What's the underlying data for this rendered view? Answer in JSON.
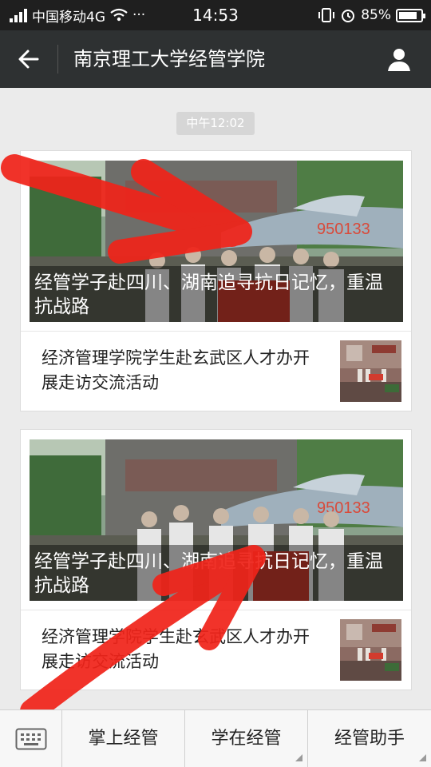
{
  "status_bar": {
    "carrier": "中国移动4G",
    "more": "···",
    "time": "14:53",
    "battery": "85%",
    "battery_level": 0.85
  },
  "nav": {
    "title": "南京理工大学经管学院"
  },
  "chat": {
    "timestamp": "中午12:02"
  },
  "articles": [
    {
      "main_title": "经管学子赴四川、湖南追寻抗日记忆，重温抗战路",
      "sub_title": "经济管理学院学生赴玄武区人才办开展走访交流活动"
    },
    {
      "main_title": "经管学子赴四川、湖南追寻抗日记忆，重温抗战路",
      "sub_title": "经济管理学院学生赴玄武区人才办开展走访交流活动"
    }
  ],
  "menu": {
    "items": [
      "掌上经管",
      "学在经管",
      "经管助手"
    ]
  },
  "colors": {
    "nav_bg": "#2e3132",
    "annotation_red": "#f0241a"
  }
}
